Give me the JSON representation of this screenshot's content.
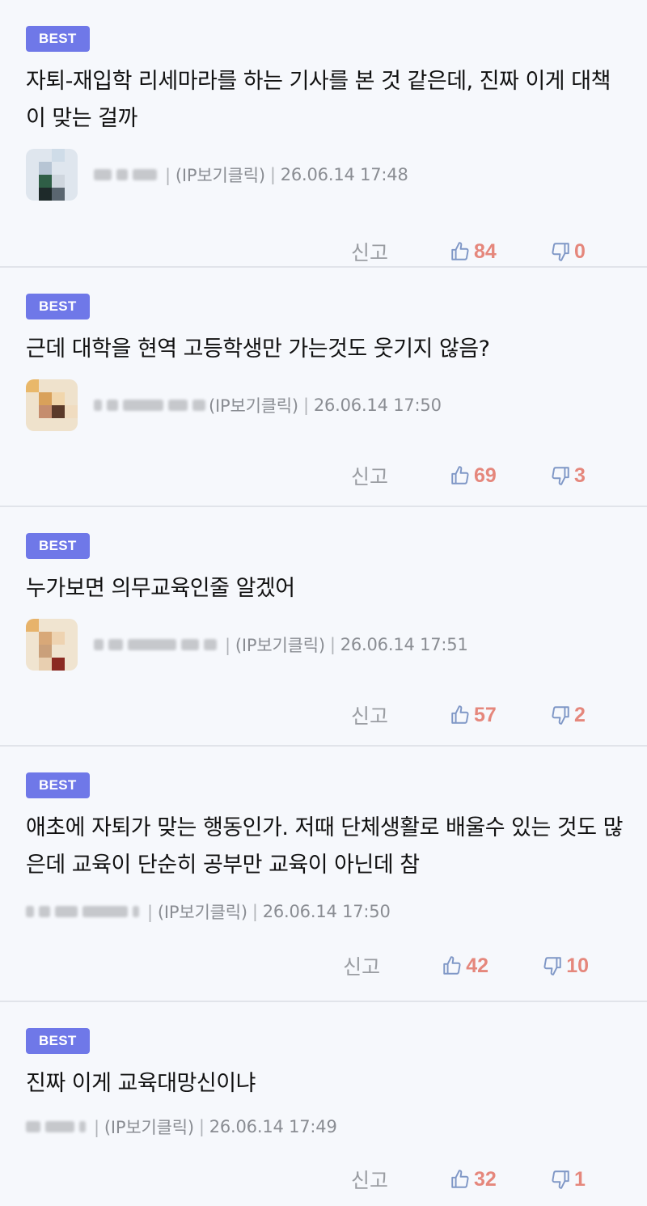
{
  "comments": [
    {
      "badge": "BEST",
      "text": "자퇴-재입학 리세마라를 하는 기사를 본 것 같은데, 진짜 이게 대책이 맞는 걸까",
      "ip_label": "(IP보기클릭)",
      "timestamp": "26.06.14 17:48",
      "report_label": "신고",
      "likes": "84",
      "dislikes": "0"
    },
    {
      "badge": "BEST",
      "text": "근데 대학을 현역 고등학생만 가는것도 웃기지 않음?",
      "ip_label": "(IP보기클릭)",
      "timestamp": "26.06.14 17:50",
      "report_label": "신고",
      "likes": "69",
      "dislikes": "3"
    },
    {
      "badge": "BEST",
      "text": "누가보면 의무교육인줄 알겠어",
      "ip_label": "(IP보기클릭)",
      "timestamp": "26.06.14 17:51",
      "report_label": "신고",
      "likes": "57",
      "dislikes": "2"
    },
    {
      "badge": "BEST",
      "text": "애초에 자퇴가 맞는 행동인가. 저때 단체생활로 배울수 있는 것도 많은데 교육이 단순히 공부만 교육이 아닌데 참",
      "ip_label": "(IP보기클릭)",
      "timestamp": "26.06.14 17:50",
      "report_label": "신고",
      "likes": "42",
      "dislikes": "10"
    },
    {
      "badge": "BEST",
      "text": "진짜 이게 교육대망신이냐",
      "ip_label": "(IP보기클릭)",
      "timestamp": "26.06.14 17:49",
      "report_label": "신고",
      "likes": "32",
      "dislikes": "1"
    }
  ],
  "colors": {
    "badge": "#6f78e8",
    "vote_count": "#e5877c",
    "vote_icon": "#7f97c6",
    "background": "#f6f8fc"
  }
}
